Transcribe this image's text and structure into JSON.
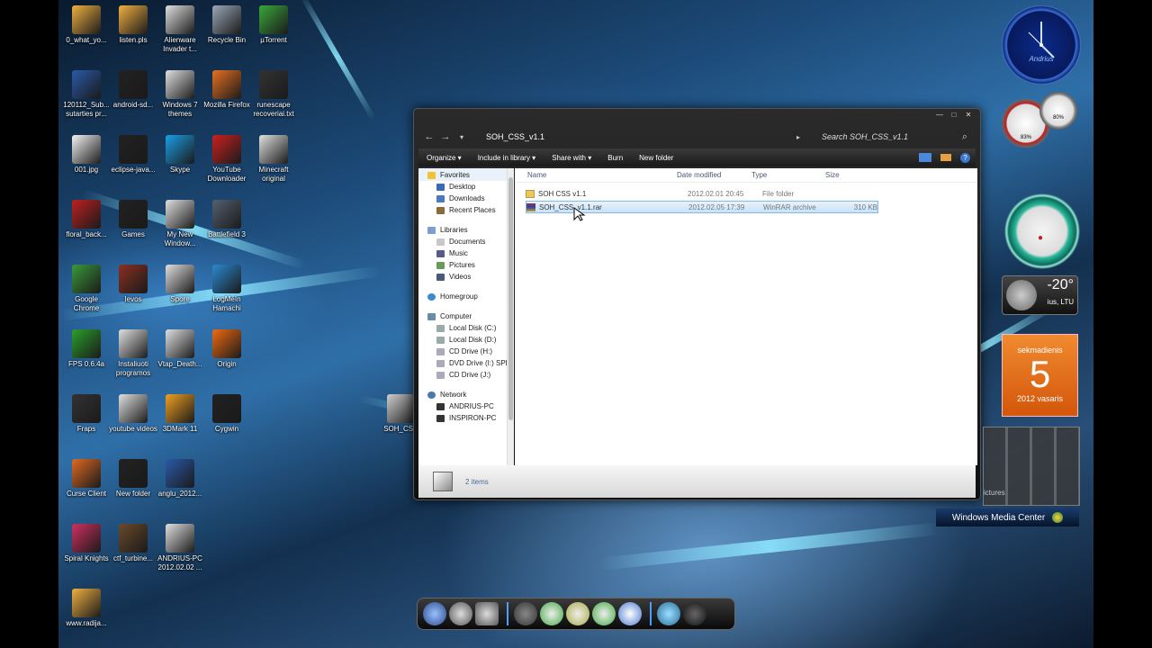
{
  "desktop_icons": [
    {
      "label": "0_what_yo...",
      "color": "#f0b040"
    },
    {
      "label": "listen.pls",
      "color": "#f0b040"
    },
    {
      "label": "Alienware Invader t...",
      "color": "#e0e0e0"
    },
    {
      "label": "Recycle Bin",
      "color": "#9aa8b8"
    },
    {
      "label": "µTorrent",
      "color": "#3aa83a"
    },
    {
      "label": "120112_Sub... sutarties pr...",
      "color": "#2a5aaa"
    },
    {
      "label": "android-sd...",
      "color": "#222222"
    },
    {
      "label": "Windows 7 themes",
      "color": "#e0e0e0"
    },
    {
      "label": "Mozilla Firefox",
      "color": "#e87020"
    },
    {
      "label": "runescape recoveriai.txt",
      "color": "#333333"
    },
    {
      "label": "001.jpg",
      "color": "#f4f4f4"
    },
    {
      "label": "eclipse-java...",
      "color": "#222222"
    },
    {
      "label": "Skype",
      "color": "#1aa0e8"
    },
    {
      "label": "YouTube Downloader",
      "color": "#cc2020"
    },
    {
      "label": "Minecraft original",
      "color": "#e0e0e0"
    },
    {
      "label": "floral_back...",
      "color": "#c02020"
    },
    {
      "label": "Games",
      "color": "#222222"
    },
    {
      "label": "My New Window...",
      "color": "#e0e0e0"
    },
    {
      "label": "Battlefield 3",
      "color": "#556070"
    },
    {
      "label": "Google Chrome",
      "color": "#3a9a3a"
    },
    {
      "label": "Ievos",
      "color": "#8a3020"
    },
    {
      "label": "Spore",
      "color": "#e0e0e0"
    },
    {
      "label": "LogMeIn Hamachi",
      "color": "#2a8ad0"
    },
    {
      "label": "FPS 0.6.4a",
      "color": "#2aa02a"
    },
    {
      "label": "Instaliuoti programos",
      "color": "#e0e0e0"
    },
    {
      "label": "Vtap_Death...",
      "color": "#e0e0e0"
    },
    {
      "label": "Origin",
      "color": "#f06a10"
    },
    {
      "label": "Fraps",
      "color": "#333333"
    },
    {
      "label": "youtube videos",
      "color": "#e0e0e0"
    },
    {
      "label": "3DMark 11",
      "color": "#f0a020"
    },
    {
      "label": "Cygwin",
      "color": "#222222"
    },
    {
      "label": "Curse Client",
      "color": "#e06a20"
    },
    {
      "label": "New folder",
      "color": "#222222"
    },
    {
      "label": "anglu_2012...",
      "color": "#2a5aaa"
    },
    {
      "label": "Spiral Knights",
      "color": "#d03060"
    },
    {
      "label": "ctf_turbine...",
      "color": "#6a4a2a"
    },
    {
      "label": "ANDRIUS-PC 2012.02.02 ...",
      "color": "#e0e0e0"
    },
    {
      "label": "www.radija...",
      "color": "#f0b040"
    },
    {
      "label": "SOH_CS...",
      "color": "#d0d0d0"
    }
  ],
  "explorer": {
    "breadcrumb": "SOH_CSS_v1.1",
    "search_placeholder": "Search SOH_CSS_v1.1",
    "toolbar": [
      "Organize ▾",
      "Include in library ▾",
      "Share with ▾",
      "Burn",
      "New folder"
    ],
    "nav": {
      "favorites": {
        "label": "Favorites",
        "items": [
          "Desktop",
          "Downloads",
          "Recent Places"
        ]
      },
      "libraries": {
        "label": "Libraries",
        "items": [
          "Documents",
          "Music",
          "Pictures",
          "Videos"
        ]
      },
      "homegroup": "Homegroup",
      "computer": {
        "label": "Computer",
        "items": [
          "Local Disk (C:)",
          "Local Disk (D:)",
          "CD Drive (H:)",
          "DVD Drive (I:) SPE",
          "CD Drive (J:)"
        ]
      },
      "network": {
        "label": "Network",
        "items": [
          "ANDRIUS-PC",
          "INSPIRON-PC"
        ]
      }
    },
    "columns": [
      "Name",
      "Date modified",
      "Type",
      "Size"
    ],
    "files": [
      {
        "name": "SOH CSS v1.1",
        "date": "2012.02.01 20:45",
        "type": "File folder",
        "size": "",
        "selected": false,
        "icon": "folder-icon"
      },
      {
        "name": "SOH_CSS_v1.1.rar",
        "date": "2012.02.05 17:39",
        "type": "WinRAR archive",
        "size": "310 KB",
        "selected": true,
        "icon": "winrar-icon"
      }
    ],
    "status": "2 items"
  },
  "gadgets": {
    "clock_label": "Andrius",
    "cpu_1": "83%",
    "cpu_2": "80%",
    "weather_temp": "-20°",
    "weather_location": "ius, LTU",
    "calendar_day_name": "sekmadienis",
    "calendar_day": "5",
    "calendar_month": "2012 vasaris",
    "media_label": "Windows Media Center",
    "pictures_label": "ictures"
  }
}
